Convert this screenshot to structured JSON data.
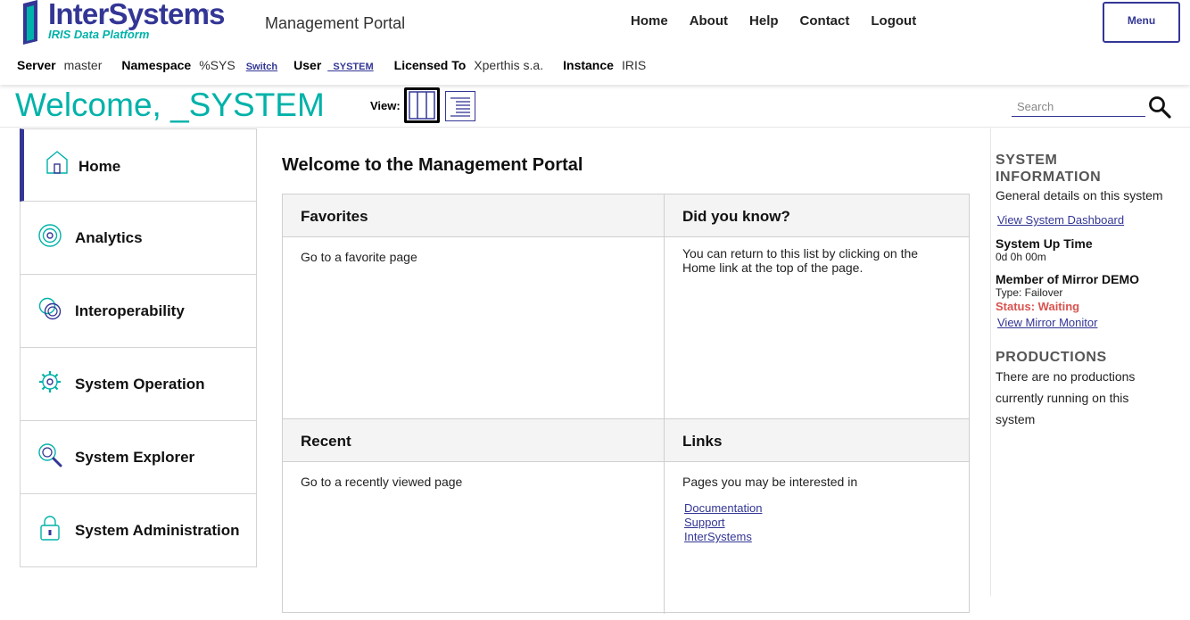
{
  "brand": {
    "logo_name": "InterSystems",
    "logo_sub": "IRIS Data Platform",
    "portal_title": "Management Portal",
    "color_primary": "#333695",
    "color_teal": "#00b2a9"
  },
  "topnav": [
    "Home",
    "About",
    "Help",
    "Contact",
    "Logout"
  ],
  "menu_label": "Menu",
  "infobar": {
    "server_label": "Server",
    "server": "master",
    "namespace_label": "Namespace",
    "namespace": "%SYS",
    "switch": "Switch",
    "user_label": "User",
    "user": "_SYSTEM",
    "licensed_label": "Licensed To",
    "licensed": "Xperthis s.a.",
    "instance_label": "Instance",
    "instance": "IRIS"
  },
  "welcome": "Welcome, _SYSTEM",
  "view_label": "View:",
  "search_placeholder": "Search",
  "sidebar": [
    {
      "label": "Home",
      "icon": "home-icon",
      "active": true
    },
    {
      "label": "Analytics",
      "icon": "analytics-icon"
    },
    {
      "label": "Interoperability",
      "icon": "interoperability-icon"
    },
    {
      "label": "System Operation",
      "icon": "gear-icon"
    },
    {
      "label": "System Explorer",
      "icon": "explorer-search-icon"
    },
    {
      "label": "System Administration",
      "icon": "lock-icon"
    }
  ],
  "main": {
    "title": "Welcome to the Management Portal",
    "favorites": {
      "title": "Favorites",
      "text": "Go to a favorite page"
    },
    "did_you_know": {
      "title": "Did you know?",
      "text": "You can return to this list by clicking on the Home link at the top of the page."
    },
    "recent": {
      "title": "Recent",
      "text": "Go to a recently viewed page"
    },
    "links": {
      "title": "Links",
      "text": "Pages you may be interested in",
      "items": [
        "Documentation",
        "Support",
        "InterSystems"
      ]
    }
  },
  "right_panel": {
    "sys_info_title": "SYSTEM INFORMATION",
    "sys_info_desc": "General details on this system",
    "dashboard_link": "View System Dashboard",
    "uptime_label": "System Up Time",
    "uptime": "0d 0h 00m",
    "mirror_label": "Member of Mirror DEMO",
    "mirror_type": "Type: Failover",
    "mirror_status": "Status: Waiting",
    "mirror_status_color": "#d9534f",
    "mirror_link": "View Mirror Monitor",
    "productions_title": "PRODUCTIONS",
    "productions_text": "There are no productions currently running on this system"
  }
}
